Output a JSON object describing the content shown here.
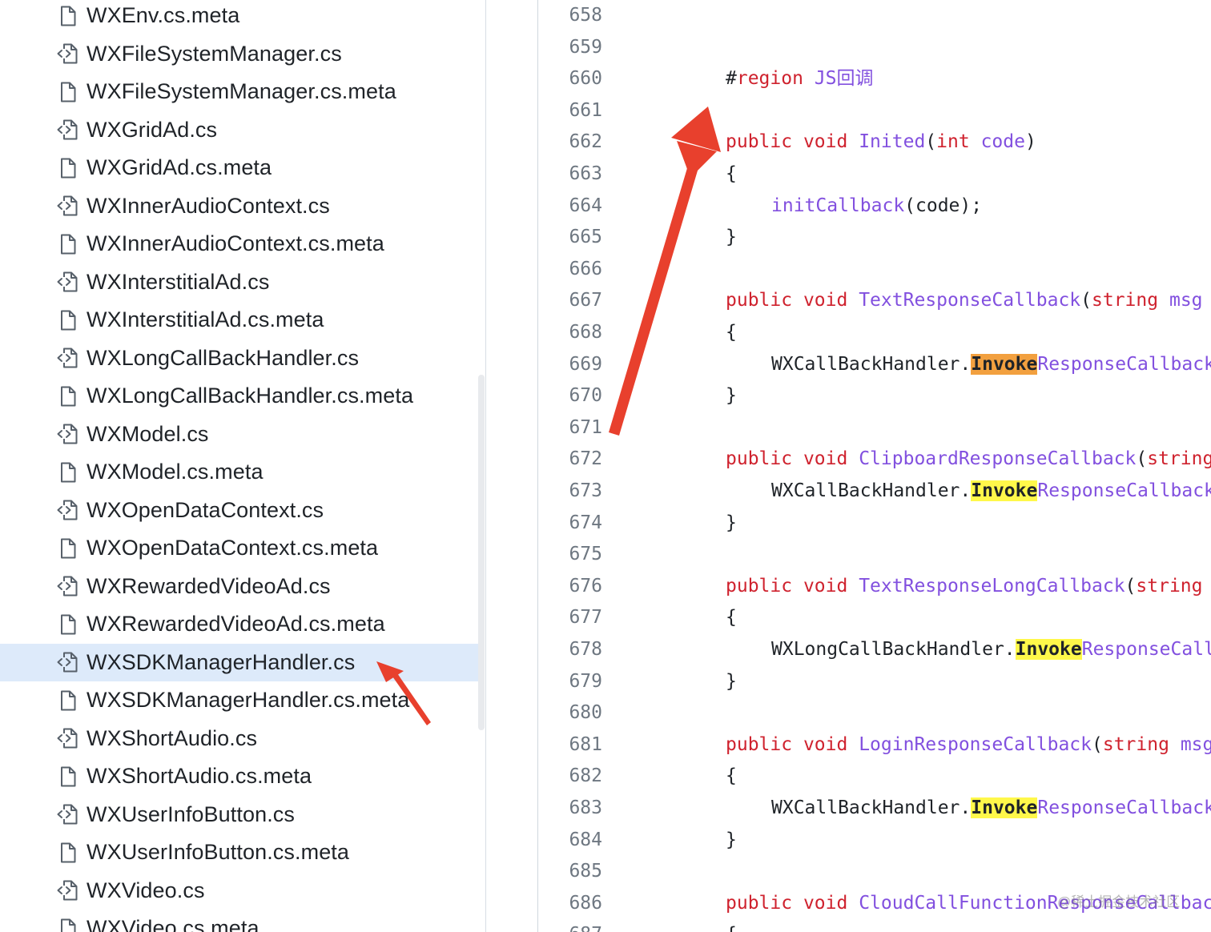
{
  "sidebar": {
    "files": [
      {
        "name": "WXEnv.cs.meta",
        "icon": "file-icon"
      },
      {
        "name": "WXFileSystemManager.cs",
        "icon": "code-file-icon"
      },
      {
        "name": "WXFileSystemManager.cs.meta",
        "icon": "file-icon"
      },
      {
        "name": "WXGridAd.cs",
        "icon": "code-file-icon"
      },
      {
        "name": "WXGridAd.cs.meta",
        "icon": "file-icon"
      },
      {
        "name": "WXInnerAudioContext.cs",
        "icon": "code-file-icon"
      },
      {
        "name": "WXInnerAudioContext.cs.meta",
        "icon": "file-icon"
      },
      {
        "name": "WXInterstitialAd.cs",
        "icon": "code-file-icon"
      },
      {
        "name": "WXInterstitialAd.cs.meta",
        "icon": "file-icon"
      },
      {
        "name": "WXLongCallBackHandler.cs",
        "icon": "code-file-icon"
      },
      {
        "name": "WXLongCallBackHandler.cs.meta",
        "icon": "file-icon"
      },
      {
        "name": "WXModel.cs",
        "icon": "code-file-icon"
      },
      {
        "name": "WXModel.cs.meta",
        "icon": "file-icon"
      },
      {
        "name": "WXOpenDataContext.cs",
        "icon": "code-file-icon"
      },
      {
        "name": "WXOpenDataContext.cs.meta",
        "icon": "file-icon"
      },
      {
        "name": "WXRewardedVideoAd.cs",
        "icon": "code-file-icon"
      },
      {
        "name": "WXRewardedVideoAd.cs.meta",
        "icon": "file-icon"
      },
      {
        "name": "WXSDKManagerHandler.cs",
        "icon": "code-file-icon",
        "selected": true
      },
      {
        "name": "WXSDKManagerHandler.cs.meta",
        "icon": "file-icon"
      },
      {
        "name": "WXShortAudio.cs",
        "icon": "code-file-icon"
      },
      {
        "name": "WXShortAudio.cs.meta",
        "icon": "file-icon"
      },
      {
        "name": "WXUserInfoButton.cs",
        "icon": "code-file-icon"
      },
      {
        "name": "WXUserInfoButton.cs.meta",
        "icon": "file-icon"
      },
      {
        "name": "WXVideo.cs",
        "icon": "code-file-icon"
      },
      {
        "name": "WXVideo.cs.meta",
        "icon": "file-icon"
      }
    ]
  },
  "editor": {
    "lines": [
      {
        "no": "658",
        "indent": 0,
        "tokens": []
      },
      {
        "no": "659",
        "indent": 0,
        "tokens": []
      },
      {
        "no": "660",
        "indent": 1,
        "tokens": [
          {
            "t": "#",
            "c": ""
          },
          {
            "t": "region",
            "c": "kw"
          },
          {
            "t": " ",
            "c": ""
          },
          {
            "t": "JS",
            "c": "fn"
          },
          {
            "t": "回调",
            "c": "fn cn"
          }
        ]
      },
      {
        "no": "661",
        "indent": 0,
        "tokens": []
      },
      {
        "no": "662",
        "indent": 1,
        "tokens": [
          {
            "t": "public",
            "c": "kw"
          },
          {
            "t": " ",
            "c": ""
          },
          {
            "t": "void",
            "c": "kw"
          },
          {
            "t": " ",
            "c": ""
          },
          {
            "t": "Inited",
            "c": "fn"
          },
          {
            "t": "(",
            "c": ""
          },
          {
            "t": "int",
            "c": "kw"
          },
          {
            "t": " ",
            "c": ""
          },
          {
            "t": "code",
            "c": "fn"
          },
          {
            "t": ")",
            "c": ""
          }
        ]
      },
      {
        "no": "663",
        "indent": 1,
        "tokens": [
          {
            "t": "{",
            "c": ""
          }
        ]
      },
      {
        "no": "664",
        "indent": 2,
        "tokens": [
          {
            "t": "initCallback",
            "c": "fn"
          },
          {
            "t": "(code);",
            "c": ""
          }
        ]
      },
      {
        "no": "665",
        "indent": 1,
        "tokens": [
          {
            "t": "}",
            "c": ""
          }
        ]
      },
      {
        "no": "666",
        "indent": 0,
        "tokens": []
      },
      {
        "no": "667",
        "indent": 1,
        "tokens": [
          {
            "t": "public",
            "c": "kw"
          },
          {
            "t": " ",
            "c": ""
          },
          {
            "t": "void",
            "c": "kw"
          },
          {
            "t": " ",
            "c": ""
          },
          {
            "t": "TextResponseCallback",
            "c": "fn"
          },
          {
            "t": "(",
            "c": ""
          },
          {
            "t": "string",
            "c": "kw"
          },
          {
            "t": " ",
            "c": ""
          },
          {
            "t": "msg",
            "c": "fn"
          }
        ]
      },
      {
        "no": "668",
        "indent": 1,
        "tokens": [
          {
            "t": "{",
            "c": ""
          }
        ]
      },
      {
        "no": "669",
        "indent": 2,
        "tokens": [
          {
            "t": "WXCallBackHandler.",
            "c": ""
          },
          {
            "t": "Invoke",
            "c": "hl-o"
          },
          {
            "t": "ResponseCallback",
            "c": "fn"
          }
        ]
      },
      {
        "no": "670",
        "indent": 1,
        "tokens": [
          {
            "t": "}",
            "c": ""
          }
        ]
      },
      {
        "no": "671",
        "indent": 0,
        "tokens": []
      },
      {
        "no": "672",
        "indent": 1,
        "tokens": [
          {
            "t": "public",
            "c": "kw"
          },
          {
            "t": " ",
            "c": ""
          },
          {
            "t": "void",
            "c": "kw"
          },
          {
            "t": " ",
            "c": ""
          },
          {
            "t": "ClipboardResponseCallback",
            "c": "fn"
          },
          {
            "t": "(",
            "c": ""
          },
          {
            "t": "string",
            "c": "kw"
          }
        ]
      },
      {
        "no": "673",
        "indent": 2,
        "tokens": [
          {
            "t": "WXCallBackHandler.",
            "c": ""
          },
          {
            "t": "Invoke",
            "c": "hl"
          },
          {
            "t": "ResponseCallback",
            "c": "fn"
          }
        ]
      },
      {
        "no": "674",
        "indent": 1,
        "tokens": [
          {
            "t": "}",
            "c": ""
          }
        ]
      },
      {
        "no": "675",
        "indent": 0,
        "tokens": []
      },
      {
        "no": "676",
        "indent": 1,
        "tokens": [
          {
            "t": "public",
            "c": "kw"
          },
          {
            "t": " ",
            "c": ""
          },
          {
            "t": "void",
            "c": "kw"
          },
          {
            "t": " ",
            "c": ""
          },
          {
            "t": "TextResponseLongCallback",
            "c": "fn"
          },
          {
            "t": "(",
            "c": ""
          },
          {
            "t": "string",
            "c": "kw"
          }
        ]
      },
      {
        "no": "677",
        "indent": 1,
        "tokens": [
          {
            "t": "{",
            "c": ""
          }
        ]
      },
      {
        "no": "678",
        "indent": 2,
        "tokens": [
          {
            "t": "WXLongCallBackHandler.",
            "c": ""
          },
          {
            "t": "Invoke",
            "c": "hl"
          },
          {
            "t": "ResponseCallback",
            "c": "fn"
          }
        ]
      },
      {
        "no": "679",
        "indent": 1,
        "tokens": [
          {
            "t": "}",
            "c": ""
          }
        ]
      },
      {
        "no": "680",
        "indent": 0,
        "tokens": []
      },
      {
        "no": "681",
        "indent": 1,
        "tokens": [
          {
            "t": "public",
            "c": "kw"
          },
          {
            "t": " ",
            "c": ""
          },
          {
            "t": "void",
            "c": "kw"
          },
          {
            "t": " ",
            "c": ""
          },
          {
            "t": "LoginResponseCallback",
            "c": "fn"
          },
          {
            "t": "(",
            "c": ""
          },
          {
            "t": "string",
            "c": "kw"
          },
          {
            "t": " ",
            "c": ""
          },
          {
            "t": "msg",
            "c": "fn"
          }
        ]
      },
      {
        "no": "682",
        "indent": 1,
        "tokens": [
          {
            "t": "{",
            "c": ""
          }
        ]
      },
      {
        "no": "683",
        "indent": 2,
        "tokens": [
          {
            "t": "WXCallBackHandler.",
            "c": ""
          },
          {
            "t": "Invoke",
            "c": "hl"
          },
          {
            "t": "ResponseCallback",
            "c": "fn"
          }
        ]
      },
      {
        "no": "684",
        "indent": 1,
        "tokens": [
          {
            "t": "}",
            "c": ""
          }
        ]
      },
      {
        "no": "685",
        "indent": 0,
        "tokens": []
      },
      {
        "no": "686",
        "indent": 1,
        "tokens": [
          {
            "t": "public",
            "c": "kw"
          },
          {
            "t": " ",
            "c": ""
          },
          {
            "t": "void",
            "c": "kw"
          },
          {
            "t": " ",
            "c": ""
          },
          {
            "t": "CloudCallFunctionResponseCallback",
            "c": "fn"
          }
        ]
      },
      {
        "no": "687",
        "indent": 1,
        "tokens": [
          {
            "t": "{",
            "c": ""
          }
        ]
      }
    ]
  },
  "watermark": "@稀土掘金技术社区",
  "colors": {
    "annotation_arrow": "#e8402d",
    "selected_row": "#ddeafa",
    "keyword": "#cf222e",
    "function": "#8250df",
    "match_highlight": "#fff84a",
    "current_match": "#f2a03f"
  }
}
